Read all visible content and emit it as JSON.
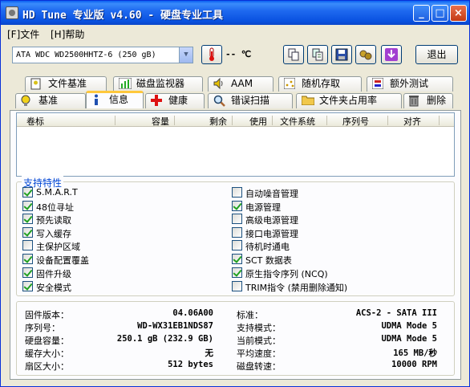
{
  "window": {
    "title": "HD Tune 专业版 v4.60 - 硬盘专业工具"
  },
  "menu": {
    "file": "[F]文件",
    "help": "[H]帮助"
  },
  "toolbar": {
    "drive": "ATA     WDC WD2500HHTZ-6 (250 gB)",
    "temperature": "-- ℃",
    "exit_label": "退出",
    "icons": [
      "thermometer-icon",
      "copy-icon",
      "copy-all-icon",
      "save-icon",
      "options-icon",
      "download-icon"
    ]
  },
  "tabs": {
    "row1": [
      "文件基准",
      "磁盘监视器",
      "AAM",
      "随机存取",
      "额外测试"
    ],
    "row2": [
      "基准",
      "信息",
      "健康",
      "错误扫描",
      "文件夹占用率",
      "删除"
    ],
    "active": "信息"
  },
  "partition_table": {
    "columns": [
      "卷标",
      "容量",
      "剩余",
      "使用",
      "文件系统",
      "序列号",
      "对齐"
    ],
    "rows": []
  },
  "features": {
    "title": "支持特性",
    "left": [
      {
        "label": "S.M.A.R.T",
        "checked": true
      },
      {
        "label": "48位寻址",
        "checked": true
      },
      {
        "label": "预先读取",
        "checked": true
      },
      {
        "label": "写入缓存",
        "checked": true
      },
      {
        "label": "主保护区域",
        "checked": false
      },
      {
        "label": "设备配置覆盖",
        "checked": true
      },
      {
        "label": "固件升级",
        "checked": true
      },
      {
        "label": "安全模式",
        "checked": true
      }
    ],
    "right": [
      {
        "label": "自动噪音管理",
        "checked": false
      },
      {
        "label": "电源管理",
        "checked": true
      },
      {
        "label": "高级电源管理",
        "checked": false
      },
      {
        "label": "接口电源管理",
        "checked": false
      },
      {
        "label": "待机时通电",
        "checked": false
      },
      {
        "label": "SCT 数据表",
        "checked": true
      },
      {
        "label": "原生指令序列 (NCQ)",
        "checked": true
      },
      {
        "label": "TRIM指令 (禁用删除通知)",
        "checked": false
      }
    ]
  },
  "info": {
    "left": [
      {
        "label": "固件版本：",
        "value": "04.06A00"
      },
      {
        "label": "序列号：",
        "value": "WD-WX31EB1NDS87"
      },
      {
        "label": "硬盘容量：",
        "value": "250.1 gB (232.9 GB)"
      },
      {
        "label": "缓存大小：",
        "value": "无"
      },
      {
        "label": "扇区大小：",
        "value": "512 bytes"
      }
    ],
    "right": [
      {
        "label": "标准：",
        "value": "ACS-2 - SATA III"
      },
      {
        "label": "支持模式：",
        "value": "UDMA Mode 5"
      },
      {
        "label": "当前模式：",
        "value": "UDMA Mode 5"
      },
      {
        "label": "平均速度：",
        "value": "165 MB/秒"
      },
      {
        "label": "磁盘转速：",
        "value": "10000 RPM"
      }
    ]
  }
}
